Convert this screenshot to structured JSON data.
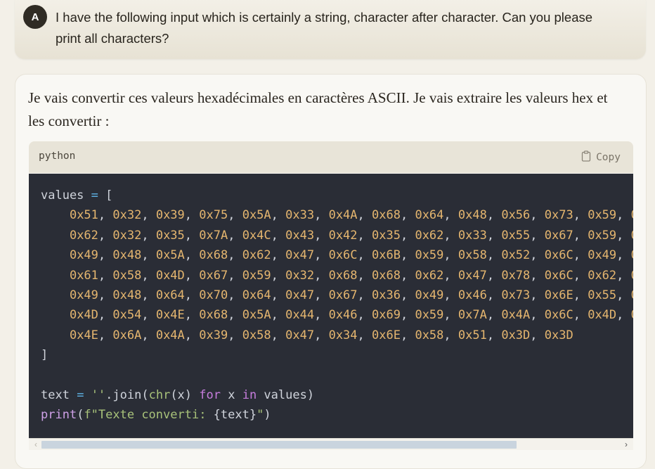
{
  "user_message": {
    "avatar_initial": "A",
    "text": "I have the following input which is certainly a string, character after character. Can you please print all characters?"
  },
  "assistant_message": {
    "intro": "Je vais convertir ces valeurs hexadécimales en caractères ASCII. Je vais extraire les valeurs hex et les convertir :",
    "code_block": {
      "language": "python",
      "copy_label": "Copy",
      "values_line": "values = [",
      "hex_rows": [
        [
          "0x51",
          "0x32",
          "0x39",
          "0x75",
          "0x5A",
          "0x33",
          "0x4A",
          "0x68",
          "0x64",
          "0x48",
          "0x56",
          "0x73",
          "0x59",
          "0"
        ],
        [
          "0x62",
          "0x32",
          "0x35",
          "0x7A",
          "0x4C",
          "0x43",
          "0x42",
          "0x35",
          "0x62",
          "0x33",
          "0x55",
          "0x67",
          "0x59",
          "0"
        ],
        [
          "0x49",
          "0x48",
          "0x5A",
          "0x68",
          "0x62",
          "0x47",
          "0x6C",
          "0x6B",
          "0x59",
          "0x58",
          "0x52",
          "0x6C",
          "0x49",
          "0"
        ],
        [
          "0x61",
          "0x58",
          "0x4D",
          "0x67",
          "0x59",
          "0x32",
          "0x68",
          "0x68",
          "0x62",
          "0x47",
          "0x78",
          "0x6C",
          "0x62",
          "0"
        ],
        [
          "0x49",
          "0x48",
          "0x64",
          "0x70",
          "0x64",
          "0x47",
          "0x67",
          "0x36",
          "0x49",
          "0x46",
          "0x73",
          "0x6E",
          "0x55",
          "0"
        ],
        [
          "0x4D",
          "0x54",
          "0x4E",
          "0x68",
          "0x5A",
          "0x44",
          "0x46",
          "0x69",
          "0x59",
          "0x7A",
          "0x4A",
          "0x6C",
          "0x4D",
          "0"
        ],
        [
          "0x4E",
          "0x6A",
          "0x4A",
          "0x39",
          "0x58",
          "0x47",
          "0x34",
          "0x6E",
          "0x58",
          "0x51",
          "0x3D",
          "0x3D"
        ]
      ],
      "closing_bracket": "]",
      "join_line": "text = ''.join(chr(x) for x in values)",
      "print_line": "print(f\"Texte converti: {text}\")"
    }
  },
  "colors": {
    "page_bg": "#f3f0e8",
    "code_bg": "#2a2d36",
    "hex": "#e5b66f",
    "keyword": "#c77dde",
    "string": "#a8c27a",
    "operator": "#5fb3e6"
  }
}
